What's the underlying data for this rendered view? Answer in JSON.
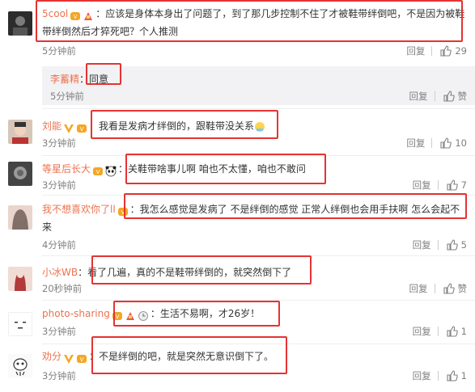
{
  "comments": [
    {
      "user": "5cool",
      "text": "：应该是身体本身出了问题了，到了那几步控制不住了才被鞋带绊倒吧，不是因为被鞋带绊倒然后才猝死吧？个人推测",
      "time": "5分钟前",
      "reply": "回复",
      "likes": "29",
      "subreply": {
        "user": "李蓄精",
        "text": "：同意",
        "time": "5分钟前",
        "reply": "回复",
        "likes": "赞"
      }
    },
    {
      "user": "刘能",
      "text": "：我看是发病才绊倒的，跟鞋带没关系",
      "time": "3分钟前",
      "reply": "回复",
      "likes": "10"
    },
    {
      "user": "等星后长大",
      "text": "：关鞋带啥事儿啊  咱也不太懂，咱也不敢问",
      "time": "3分钟前",
      "reply": "回复",
      "likes": "7"
    },
    {
      "user": "我不想喜欢你了ll",
      "text": "：我怎么感觉是发病了 不是绊倒的感觉 正常人绊倒也会用手扶啊 怎么会起不来",
      "time": "4分钟前",
      "reply": "回复",
      "likes": "5"
    },
    {
      "user": "小冰WB",
      "text": "：看了几遍，真的不是鞋带绊倒的，就突然倒下了",
      "time": "20秒钟前",
      "reply": "回复",
      "likes": "赞"
    },
    {
      "user": "photo-sharing",
      "text": "：生活不易啊，才26岁！",
      "time": "3分钟前",
      "reply": "回复",
      "likes": "1"
    },
    {
      "user": "劝分",
      "text": "：不是绊倒的吧，就是突然无意识倒下了。",
      "time": "3分钟前",
      "reply": "回复",
      "likes": "1"
    }
  ],
  "colors": {
    "username": "#eb7350",
    "highlight": "#e53333",
    "meta": "#808080"
  }
}
